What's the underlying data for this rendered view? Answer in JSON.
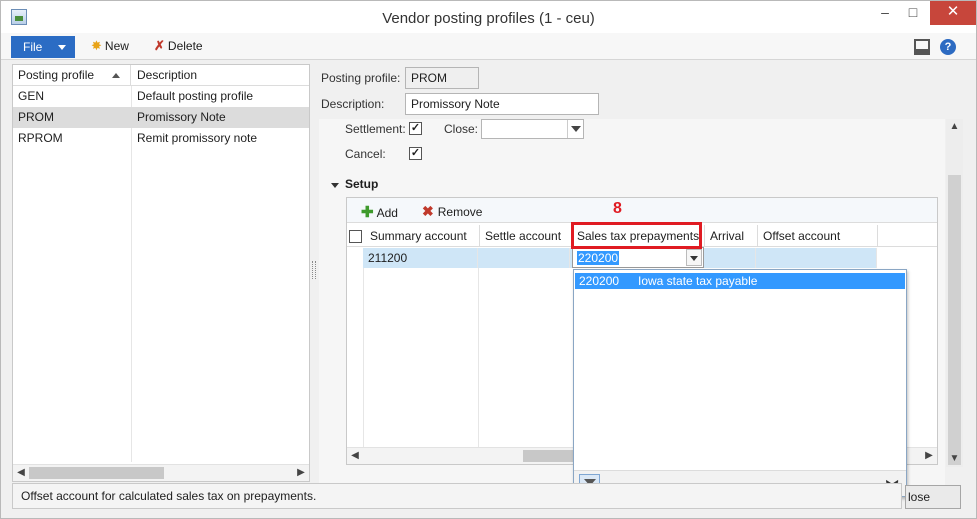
{
  "window": {
    "title": "Vendor posting profiles (1 - ceu)",
    "minimize": "–",
    "maximize": "□",
    "close": "✕"
  },
  "toolbar": {
    "file_label": "File",
    "new_label": "New",
    "delete_label": "Delete"
  },
  "profiles": {
    "columns": [
      "Posting profile",
      "Description"
    ],
    "rows": [
      {
        "profile": "GEN",
        "description": "Default posting profile"
      },
      {
        "profile": "PROM",
        "description": "Promissory Note"
      },
      {
        "profile": "RPROM",
        "description": "Remit promissory note"
      }
    ],
    "selected_index": 1
  },
  "form": {
    "posting_profile_label": "Posting profile:",
    "posting_profile_value": "PROM",
    "description_label": "Description:",
    "description_value": "Promissory Note",
    "settlement_label": "Settlement:",
    "settlement_checked": true,
    "close_label": "Close:",
    "close_value": "",
    "cancel_label": "Cancel:",
    "cancel_checked": true
  },
  "setup": {
    "title": "Setup",
    "add_label": "Add",
    "remove_label": "Remove",
    "columns": [
      "Summary account",
      "Settle account",
      "Sales tax prepayments",
      "Arrival",
      "Offset account"
    ],
    "row": {
      "summary_account": "211200",
      "settle_account": "",
      "sales_tax_prepayments": "220200",
      "arrival": "",
      "offset_account": ""
    }
  },
  "lookup": {
    "rows": [
      {
        "code": "220200",
        "description": "Iowa state tax payable"
      }
    ]
  },
  "annotation": {
    "step": "8"
  },
  "status": {
    "text": "Offset account for calculated sales tax on prepayments.",
    "close_button": "lose"
  },
  "colors": {
    "accent": "#2b6cc4",
    "highlight": "#3399ff",
    "annotation": "#e01b22",
    "close_red": "#c7463b"
  }
}
